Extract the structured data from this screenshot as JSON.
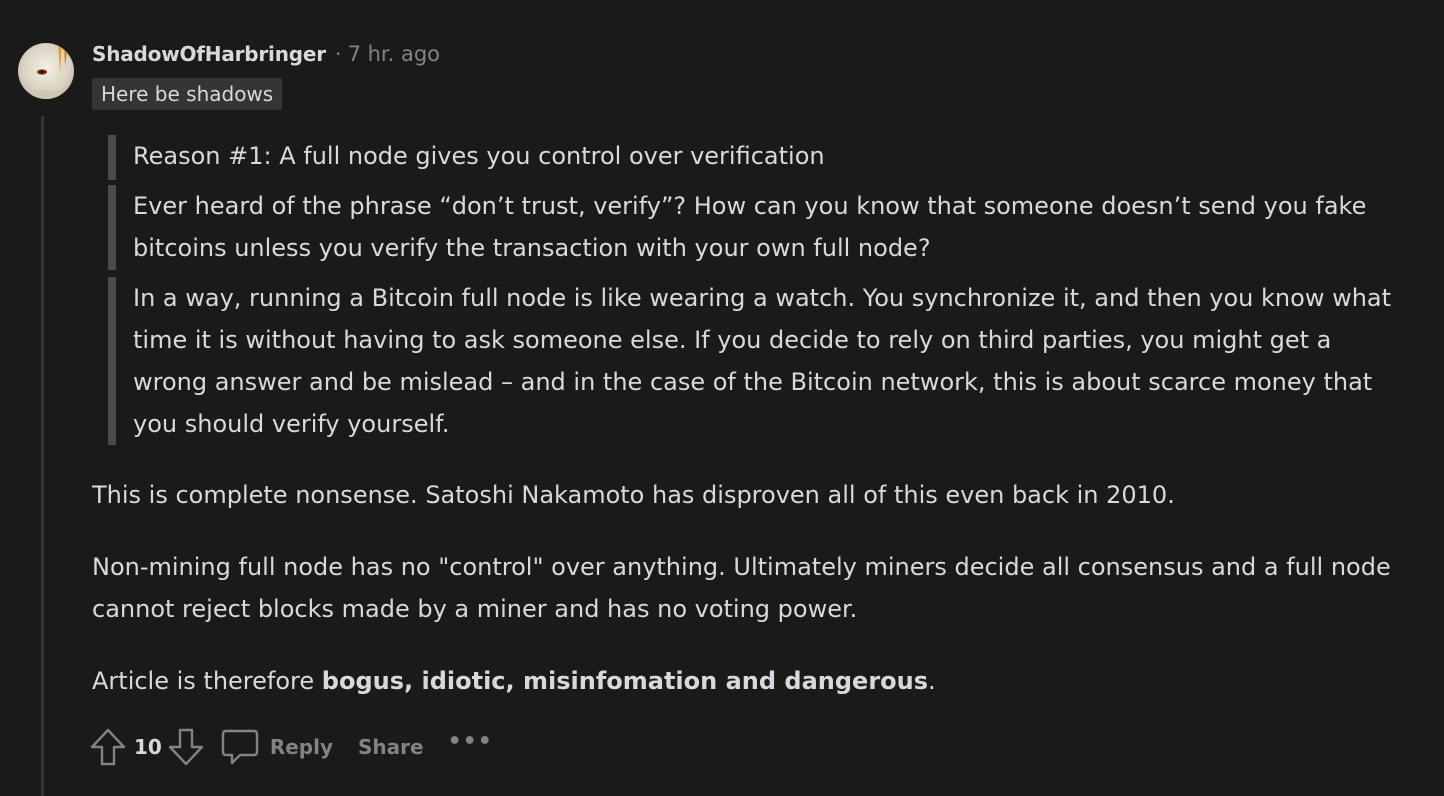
{
  "comment": {
    "username": "ShadowOfHarbringer",
    "separator": "·",
    "timestamp": "7 hr. ago",
    "flair": "Here be shadows",
    "quotes": [
      "Reason #1: A full node gives you control over verification",
      "Ever heard of the phrase “don’t trust, verify”? How can you know that someone doesn’t send you fake bitcoins unless you verify the transaction with your own full node?",
      "In a way, running a Bitcoin full node is like wearing a watch. You synchronize it, and then you know what time it is without having to ask someone else. If you decide to rely on third parties, you might get a wrong answer and be mislead – and in the case of the Bitcoin network, this is about scarce money that you should verify yourself."
    ],
    "paragraphs": [
      "This is complete nonsense. Satoshi Nakamoto has disproven all of this even back in 2010.",
      "Non-mining full node has no \"control\" over anything. Ultimately miners decide all consensus and a full node cannot reject blocks made by a miner and has no voting power."
    ],
    "final_paragraph": {
      "prefix": "Article is therefore ",
      "bold": "bogus, idiotic, misinfomation and dangerous",
      "suffix": "."
    }
  },
  "actions": {
    "vote_count": "10",
    "reply_label": "Reply",
    "share_label": "Share",
    "more_label": "•••"
  },
  "icons": {
    "avatar": "avatar",
    "upvote": "upvote-arrow-icon",
    "downvote": "downvote-arrow-icon",
    "reply": "speech-bubble-icon",
    "more": "more-dots-icon"
  },
  "colors": {
    "background": "#1a1a1b",
    "text": "#d7dadc",
    "muted": "#818384",
    "quote_bar": "#4a4b4c"
  }
}
